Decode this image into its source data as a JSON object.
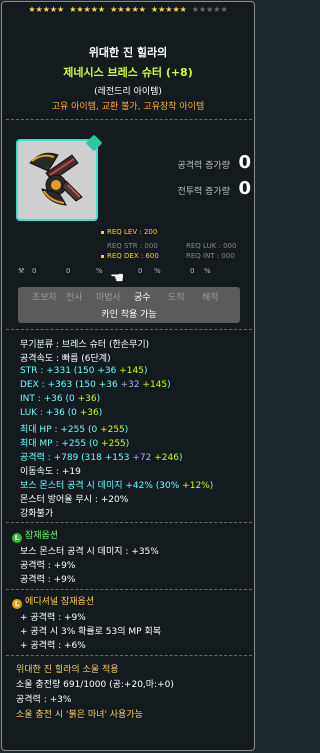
{
  "stars": {
    "filled": 20,
    "total": 25
  },
  "item": {
    "title_line1": "위대한 진 힐라의",
    "title_line2": "제네시스 브레스 슈터 (+8)",
    "grade": "(레전드리 아이템)",
    "attributes": "고유 아이템, 교환 불가, 고유장착 아이템",
    "icon": "crossbow-icon",
    "grade_color": "#3fe0c8"
  },
  "increase": {
    "attack_label": "공격력 증가량",
    "attack_value": "0",
    "combat_label": "전투력 증가량",
    "combat_value": "0"
  },
  "requirements": {
    "lev": "REQ LEV : 200",
    "str": "REQ STR : 000",
    "dex": "REQ DEX : 600",
    "luk": "REQ LUK : 000",
    "int": "REQ INT : 000"
  },
  "set_row": {
    "a": "0",
    "b": "0",
    "c": "0",
    "d": "0",
    "e": "0"
  },
  "jobs": {
    "beginner": "초보자",
    "warrior": "전사",
    "magician": "마법사",
    "archer": "궁수",
    "thief": "도적",
    "pirate": "해적",
    "karma": "카인 착용 가능"
  },
  "stats": {
    "weapon_type": "무기분류 : 브레스 슈터 (한손무기)",
    "attack_speed": "공격속도 : 빠름 (6단계)",
    "str": {
      "label": "STR : +331 (150 ",
      "plus1": "+36",
      "plus2": "+145",
      "end": ")"
    },
    "dex": {
      "label": "DEX : +363 (150 ",
      "plus1": "+36",
      "plus2": "+32",
      "plus3": "+145",
      "end": ")"
    },
    "int": {
      "label": "INT : +36 (0 ",
      "plus1": "+36",
      "end": ")"
    },
    "luk": {
      "label": "LUK : +36 (0 ",
      "plus1": "+36",
      "end": ")"
    },
    "hp": {
      "label": "최대 HP : +255 (0 ",
      "plus1": "+255",
      "end": ")"
    },
    "mp": {
      "label": "최대 MP : +255 (0 ",
      "plus1": "+255",
      "end": ")"
    },
    "attack": {
      "label": "공격력 : +789 (318 ",
      "plus1": "+153",
      "plus2": "+72",
      "plus3": "+246",
      "end": ")"
    },
    "move_speed": "이동속도 : +19",
    "boss": {
      "label": "보스 몬스터 공격 시 데미지 +42% (30% ",
      "plus1": "+12%",
      "end": ")"
    },
    "ignore_def": "몬스터 방어율 무시 : +20%",
    "enhance": "강화불가"
  },
  "potential": {
    "title": "잠재옵션",
    "badge": "L",
    "lines": [
      "보스 몬스터 공격 시 데미지 : +35%",
      "공격력 : +9%",
      "공격력 : +9%"
    ]
  },
  "additional": {
    "title": "에디셔널 잠재옵션",
    "badge": "L",
    "lines": [
      "+ 공격력 : +9%",
      "+ 공격 시 3% 확률로 53의 MP 회복",
      "+ 공격력 : +6%"
    ]
  },
  "soul": {
    "title": "위대한 진 힐라의 소울 적용",
    "charge": "소울 충전량 691/1000 (공:+20,마:+0)",
    "attack": "공격력 : +3%",
    "note": "소울 충전 시 '붉은 마녀' 사용가능"
  }
}
